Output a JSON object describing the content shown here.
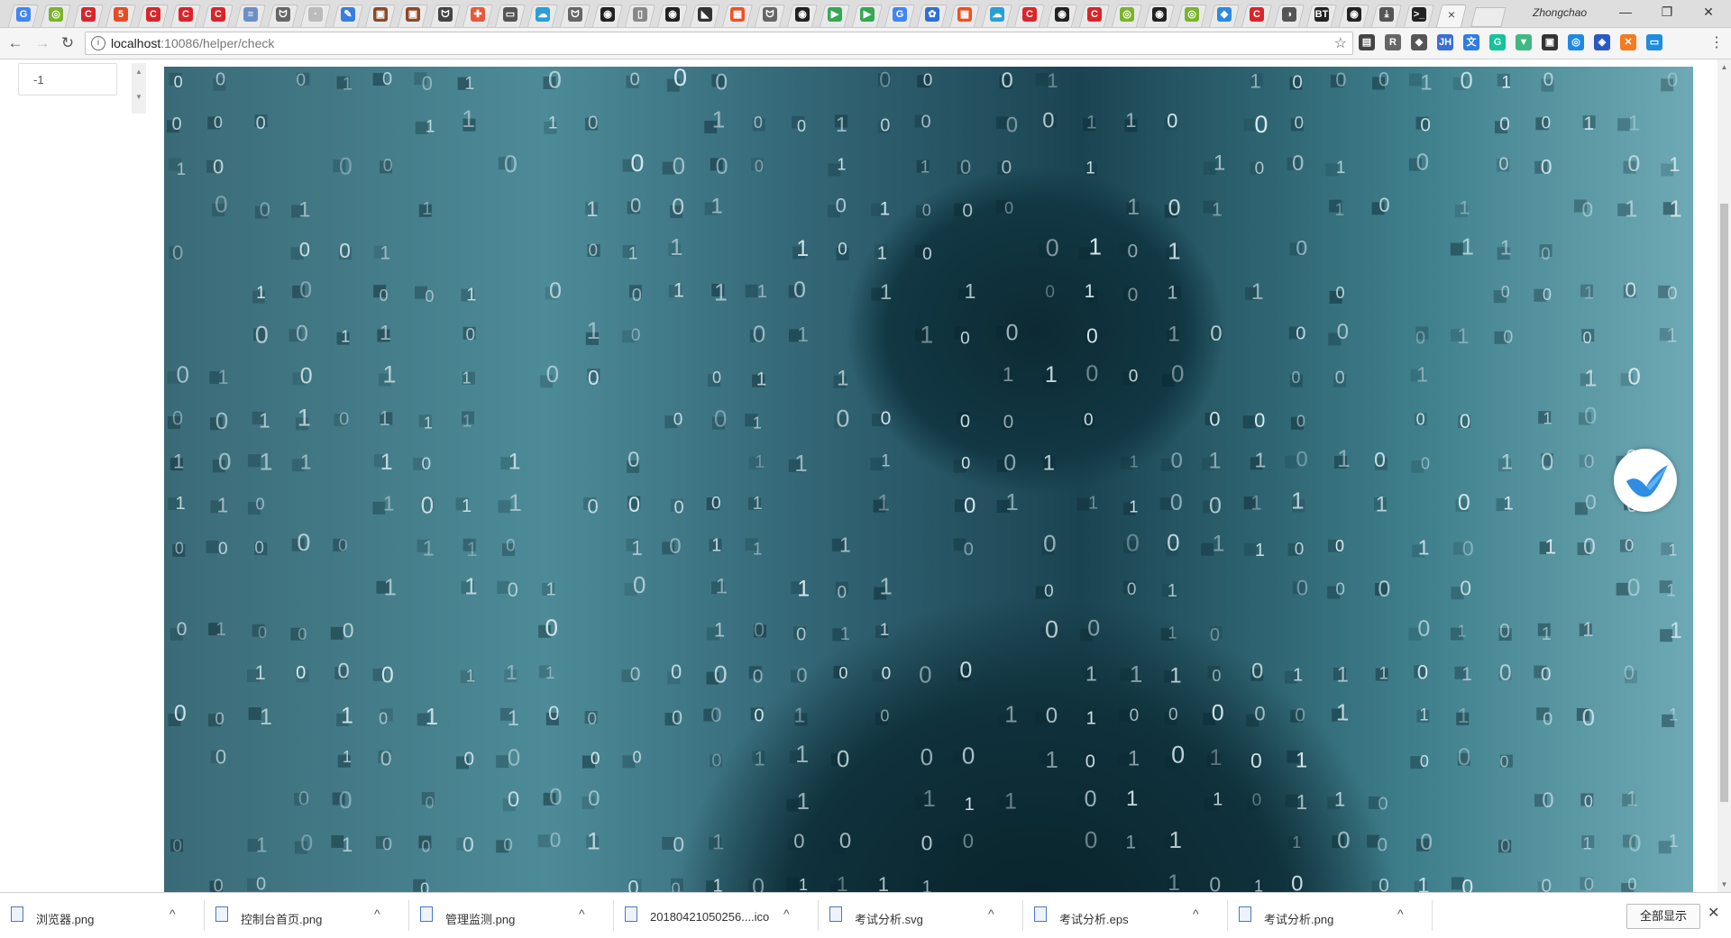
{
  "browser": {
    "profile_name": "Zhongchao",
    "tabs": [
      {
        "icon": "google-icon",
        "glyph": "G",
        "color": "#4285f4"
      },
      {
        "icon": "wechat-icon",
        "glyph": "◎",
        "color": "#7bb32e"
      },
      {
        "icon": "c-icon",
        "glyph": "C",
        "color": "#d9252a"
      },
      {
        "icon": "html5-icon",
        "glyph": "5",
        "color": "#e44d26"
      },
      {
        "icon": "c-icon",
        "glyph": "C",
        "color": "#d9252a"
      },
      {
        "icon": "c-icon",
        "glyph": "C",
        "color": "#d9252a"
      },
      {
        "icon": "c-icon",
        "glyph": "C",
        "color": "#d9252a"
      },
      {
        "icon": "doc-icon",
        "glyph": "≡",
        "color": "#6d8fc7"
      },
      {
        "icon": "cat-icon",
        "glyph": "ᗢ",
        "color": "#666666"
      },
      {
        "icon": "blank-icon",
        "glyph": "·",
        "color": "#bbbbbb"
      },
      {
        "icon": "pen-icon",
        "glyph": "✎",
        "color": "#3b7ddd"
      },
      {
        "icon": "image-icon",
        "glyph": "▣",
        "color": "#8a4a2a"
      },
      {
        "icon": "image-icon",
        "glyph": "▣",
        "color": "#8a4a2a"
      },
      {
        "icon": "anime-icon",
        "glyph": "ᗢ",
        "color": "#444444"
      },
      {
        "icon": "puzzle-icon",
        "glyph": "✚",
        "color": "#e8583a"
      },
      {
        "icon": "code-icon",
        "glyph": "▭",
        "color": "#555555"
      },
      {
        "icon": "cloud-icon",
        "glyph": "☁",
        "color": "#2a9fd6"
      },
      {
        "icon": "cat-icon",
        "glyph": "ᗢ",
        "color": "#666666"
      },
      {
        "icon": "github-icon",
        "glyph": "◉",
        "color": "#222222"
      },
      {
        "icon": "file-icon",
        "glyph": "▯",
        "color": "#888888"
      },
      {
        "icon": "github-icon",
        "glyph": "◉",
        "color": "#222222"
      },
      {
        "icon": "rss-icon",
        "glyph": "◣",
        "color": "#333333"
      },
      {
        "icon": "windows-icon",
        "glyph": "▦",
        "color": "#f25022"
      },
      {
        "icon": "cat-icon",
        "glyph": "ᗢ",
        "color": "#666666"
      },
      {
        "icon": "github-icon",
        "glyph": "◉",
        "color": "#222222"
      },
      {
        "icon": "play-icon",
        "glyph": "▶",
        "color": "#34a853"
      },
      {
        "icon": "play-icon",
        "glyph": "▶",
        "color": "#34a853"
      },
      {
        "icon": "google-icon",
        "glyph": "G",
        "color": "#4285f4"
      },
      {
        "icon": "paw-icon",
        "glyph": "✿",
        "color": "#2f6fd6"
      },
      {
        "icon": "windows-icon",
        "glyph": "▦",
        "color": "#f25022"
      },
      {
        "icon": "cloud-icon",
        "glyph": "☁",
        "color": "#2a9fd6"
      },
      {
        "icon": "c-icon",
        "glyph": "C",
        "color": "#d9252a"
      },
      {
        "icon": "github-icon",
        "glyph": "◉",
        "color": "#222222"
      },
      {
        "icon": "c-icon",
        "glyph": "C",
        "color": "#d9252a"
      },
      {
        "icon": "wechat-icon",
        "glyph": "◎",
        "color": "#7bb32e"
      },
      {
        "icon": "github-icon",
        "glyph": "◉",
        "color": "#222222"
      },
      {
        "icon": "wechat-icon",
        "glyph": "◎",
        "color": "#7bb32e"
      },
      {
        "icon": "vscode-icon",
        "glyph": "◆",
        "color": "#2b8ae0"
      },
      {
        "icon": "c-icon",
        "glyph": "C",
        "color": "#d9252a"
      },
      {
        "icon": "media-icon",
        "glyph": "◑",
        "color": "#555555"
      },
      {
        "icon": "bt-icon",
        "glyph": "BT",
        "color": "#222222"
      },
      {
        "icon": "github-icon",
        "glyph": "◉",
        "color": "#222222"
      },
      {
        "icon": "download-icon",
        "glyph": "⤓",
        "color": "#555555"
      },
      {
        "icon": "terminal-icon",
        "glyph": ">_",
        "color": "#222222"
      }
    ],
    "active_tab_close": "×",
    "address_url_host": "localhost",
    "address_url_path": ":10086/helper/check",
    "extensions": [
      {
        "icon": "reader-icon",
        "glyph": "▤",
        "color": "#444444"
      },
      {
        "icon": "r-icon",
        "glyph": "R",
        "color": "#666666"
      },
      {
        "icon": "evernote-icon",
        "glyph": "◆",
        "color": "#555555"
      },
      {
        "icon": "jh-icon",
        "glyph": "JH",
        "color": "#3b6fd6"
      },
      {
        "icon": "translate-icon",
        "glyph": "文",
        "color": "#2f7de1"
      },
      {
        "icon": "grammarly-icon",
        "glyph": "G",
        "color": "#15c39a"
      },
      {
        "icon": "vue-icon",
        "glyph": "▼",
        "color": "#41b883"
      },
      {
        "icon": "wallet-icon",
        "glyph": "▣",
        "color": "#333333"
      },
      {
        "icon": "compass-icon",
        "glyph": "◎",
        "color": "#1e88e5"
      },
      {
        "icon": "shield-icon",
        "glyph": "◈",
        "color": "#2b59c3"
      },
      {
        "icon": "fox-icon",
        "glyph": "✕",
        "color": "#f47b20"
      },
      {
        "icon": "screen-icon",
        "glyph": "▭",
        "color": "#1f8ce0"
      }
    ]
  },
  "page": {
    "number_input_value": "-1"
  },
  "downloads": [
    {
      "name": "浏览器.png"
    },
    {
      "name": "控制台首页.png"
    },
    {
      "name": "管理监测.png"
    },
    {
      "name": "20180421050256....ico"
    },
    {
      "name": "考试分析.svg"
    },
    {
      "name": "考试分析.eps"
    },
    {
      "name": "考试分析.png"
    }
  ],
  "show_all_label": "全部显示"
}
